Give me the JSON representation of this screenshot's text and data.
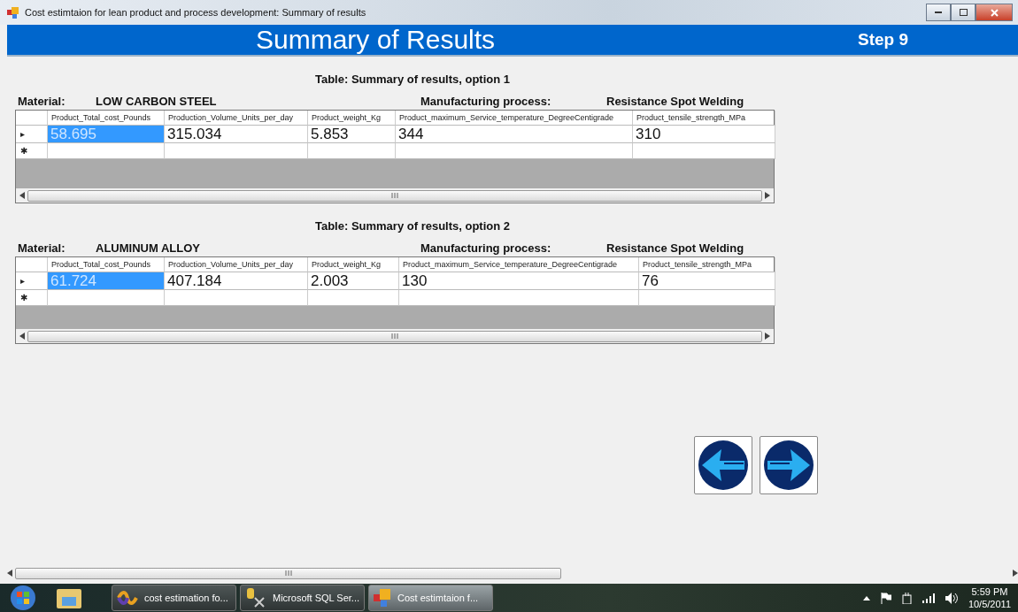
{
  "window": {
    "title": "Cost estimtaion for lean product and process development: Summary of results"
  },
  "header": {
    "title": "Summary of Results",
    "step": "Step 9"
  },
  "options": [
    {
      "title": "Table: Summary of results, option 1",
      "material_label": "Material:",
      "material": "LOW CARBON STEEL",
      "process_label": "Manufacturing process:",
      "process": "Resistance Spot Welding",
      "columns": [
        "Product_Total_cost_Pounds",
        "Production_Volume_Units_per_day",
        "Product_weight_Kg",
        "Product_maximum_Service_temperature_DegreeCentigrade",
        "Product_tensile_strength_MPa"
      ],
      "rows": [
        {
          "marker": "▸",
          "cells": [
            {
              "value": "58.695",
              "selected": true
            },
            {
              "value": "315.034",
              "selected": false
            },
            {
              "value": "5.853",
              "selected": false
            },
            {
              "value": "344",
              "selected": false
            },
            {
              "value": "310",
              "selected": false
            }
          ]
        },
        {
          "marker": "✱",
          "cells": [
            {
              "selected": false
            },
            {
              "selected": false
            },
            {
              "selected": false
            },
            {
              "selected": false
            },
            {
              "selected": false
            }
          ]
        }
      ]
    },
    {
      "title": "Table: Summary of results, option 2",
      "material_label": "Material:",
      "material": "ALUMINUM ALLOY",
      "process_label": "Manufacturing process:",
      "process": "Resistance Spot Welding",
      "columns": [
        "Product_Total_cost_Pounds",
        "Production_Volume_Units_per_day",
        "Product_weight_Kg",
        "Product_maximum_Service_temperature_DegreeCentigrade",
        "Product_tensile_strength_MPa"
      ],
      "rows": [
        {
          "marker": "▸",
          "cells": [
            {
              "value": "61.724",
              "selected": true
            },
            {
              "value": "407.184",
              "selected": false
            },
            {
              "value": "2.003",
              "selected": false
            },
            {
              "value": "130",
              "selected": false
            },
            {
              "value": "76",
              "selected": false
            }
          ]
        },
        {
          "marker": "✱",
          "cells": [
            {
              "selected": false
            },
            {
              "selected": false
            },
            {
              "selected": false
            },
            {
              "selected": false
            },
            {
              "selected": false
            }
          ]
        }
      ]
    }
  ],
  "nav_buttons": [
    {
      "kind": "back"
    },
    {
      "kind": "next"
    }
  ],
  "taskbar": {
    "items": [
      {
        "label": "cost estimation fo...",
        "kind": "studio",
        "active": false
      },
      {
        "label": "Microsoft SQL Ser...",
        "kind": "sql",
        "active": false
      },
      {
        "label": "Cost estimtaion f...",
        "kind": "app",
        "active": true
      }
    ],
    "time": "5:59 PM",
    "date": "10/5/2011"
  }
}
